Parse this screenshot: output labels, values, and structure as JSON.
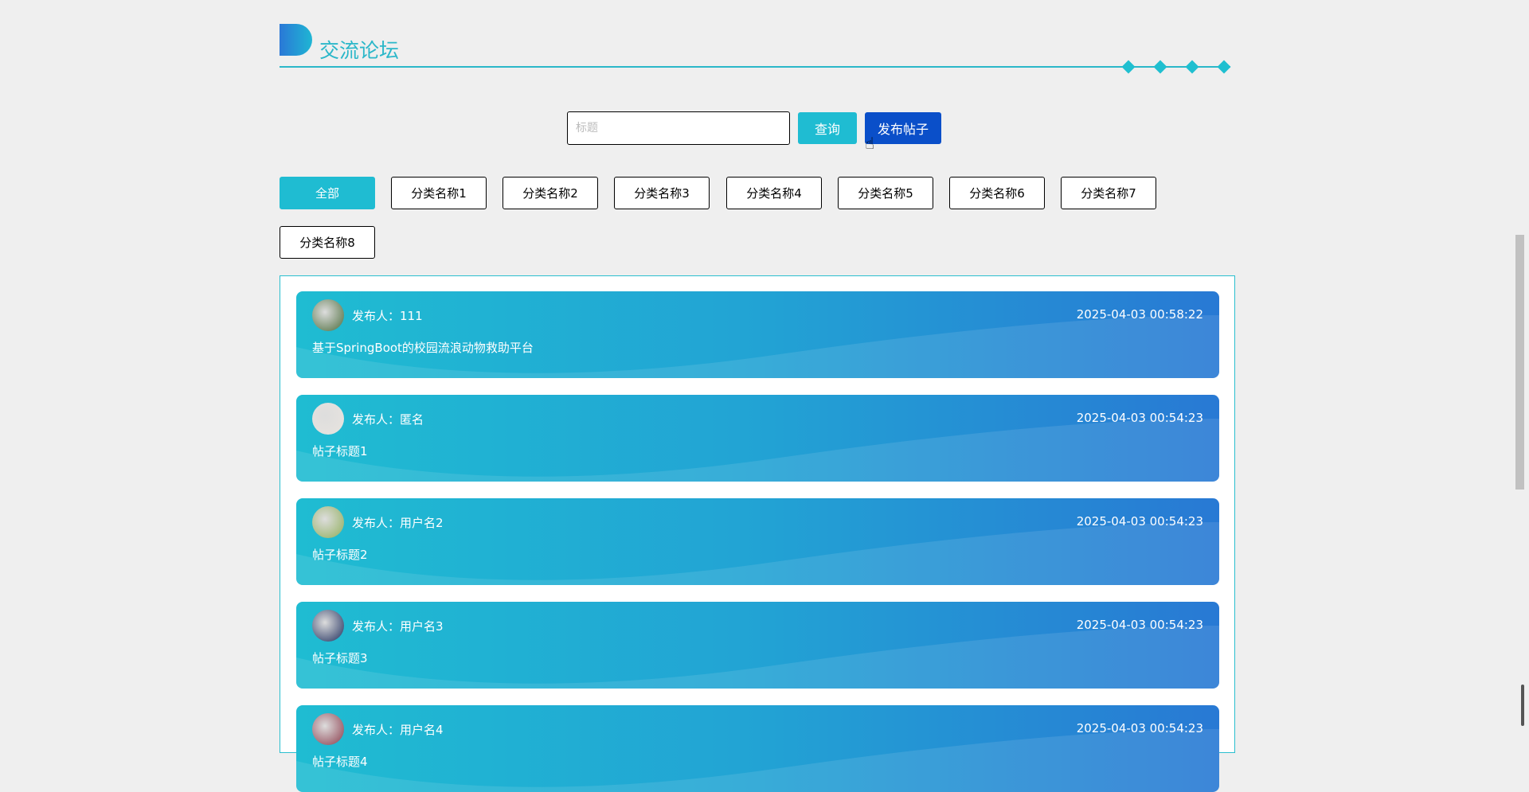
{
  "header": {
    "title": "交流论坛"
  },
  "search": {
    "placeholder": "标题",
    "value": "",
    "query_label": "查询",
    "publish_label": "发布帖子"
  },
  "categories": [
    "全部",
    "分类名称1",
    "分类名称2",
    "分类名称3",
    "分类名称4",
    "分类名称5",
    "分类名称6",
    "分类名称7",
    "分类名称8"
  ],
  "posts": [
    {
      "author": "发布人：111",
      "date": "2025-04-03 00:58:22",
      "title": "基于SpringBoot的校园流浪动物救助平台",
      "avatar": "#4a6b3a"
    },
    {
      "author": "发布人：匿名",
      "date": "2025-04-03 00:54:23",
      "title": "帖子标题1",
      "avatar": "#e8e4de"
    },
    {
      "author": "发布人：用户名2",
      "date": "2025-04-03 00:54:23",
      "title": "帖子标题2",
      "avatar": "#8fae5a"
    },
    {
      "author": "发布人：用户名3",
      "date": "2025-04-03 00:54:23",
      "title": "帖子标题3",
      "avatar": "#1c2c5c"
    },
    {
      "author": "发布人：用户名4",
      "date": "2025-04-03 00:54:23",
      "title": "帖子标题4",
      "avatar": "#8a3a4a"
    }
  ],
  "colors": {
    "accent": "#1fbcd2",
    "publish": "#0a4fc9"
  }
}
